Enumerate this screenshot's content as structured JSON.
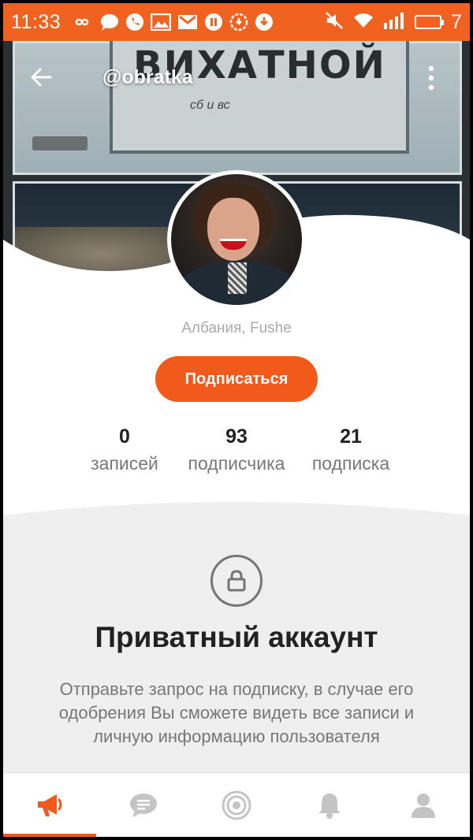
{
  "status_bar": {
    "time": "11:33",
    "battery_level": "7",
    "icons": [
      "infinity-icon",
      "chat-bubble-icon",
      "viber-icon",
      "image-icon",
      "gmail-icon",
      "pause-icon",
      "sync-icon",
      "download-icon",
      "muted-icon",
      "wifi-icon",
      "signal-icon",
      "battery-icon"
    ]
  },
  "header": {
    "handle": "@obratka",
    "back_icon": "arrow-left-icon",
    "menu_icon": "more-vert-icon"
  },
  "cover": {
    "sign_text": "ВИХАТНОЙ",
    "sign_small_text": "сб и вс"
  },
  "profile": {
    "location": "Албания, Fushe",
    "subscribe_label": "Подписаться",
    "stats": [
      {
        "value": "0",
        "label": "записей"
      },
      {
        "value": "93",
        "label": "подписчика"
      },
      {
        "value": "21",
        "label": "подписка"
      }
    ]
  },
  "private": {
    "icon": "lock-icon",
    "title": "Приватный аккаунт",
    "description": "Отправьте запрос на подписку, в случае его одобрения Вы сможете видеть все записи и личную информацию пользователя"
  },
  "bottom_nav": {
    "items": [
      {
        "icon": "megaphone-icon",
        "active": true
      },
      {
        "icon": "chat-icon",
        "active": false
      },
      {
        "icon": "target-icon",
        "active": false
      },
      {
        "icon": "bell-icon",
        "active": false
      },
      {
        "icon": "person-icon",
        "active": false
      }
    ]
  },
  "colors": {
    "accent": "#f15a1b",
    "status_bar": "#f0621f",
    "private_bg": "#efefef",
    "icon_gray": "#c4c4c4"
  }
}
